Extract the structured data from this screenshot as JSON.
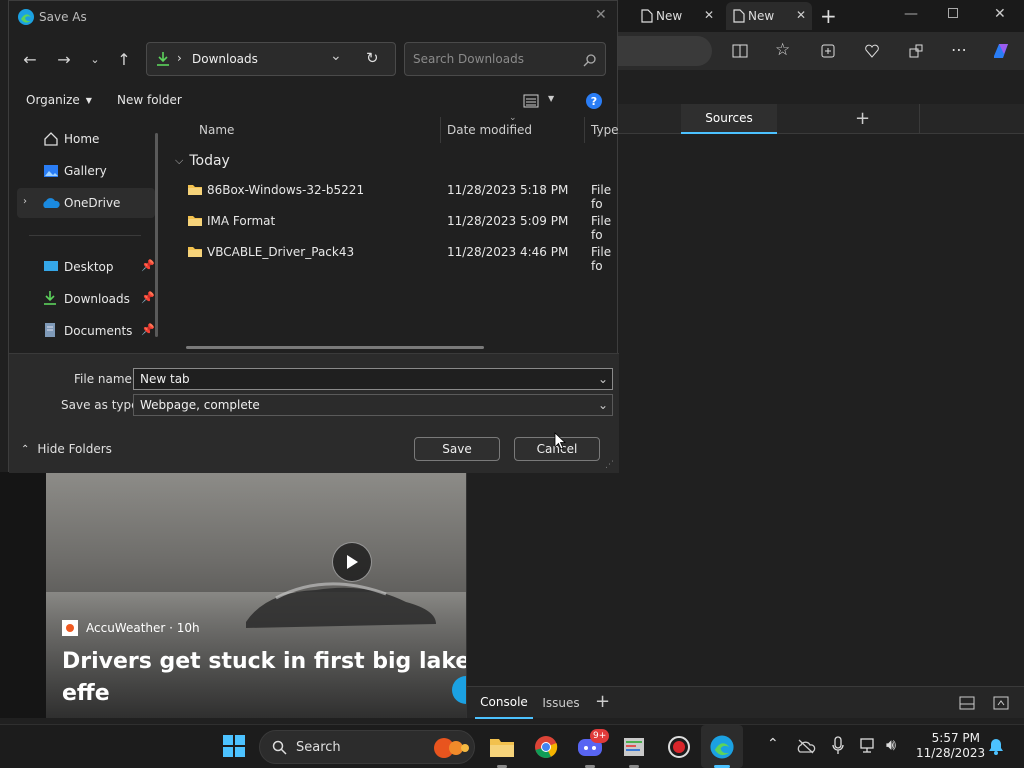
{
  "dialog": {
    "title": "Save As",
    "address": {
      "location": "Downloads"
    },
    "search": {
      "placeholder": "Search Downloads"
    },
    "commands": {
      "organize": "Organize",
      "new_folder": "New folder"
    },
    "sidebar": {
      "items": [
        {
          "label": "Home",
          "icon": "home-icon"
        },
        {
          "label": "Gallery",
          "icon": "gallery-icon"
        },
        {
          "label": "OneDrive",
          "icon": "onedrive-cloud-icon"
        },
        {
          "label": "Desktop",
          "icon": "desktop-icon",
          "pinned": true
        },
        {
          "label": "Downloads",
          "icon": "download-icon",
          "pinned": true
        },
        {
          "label": "Documents",
          "icon": "document-icon",
          "pinned": true
        }
      ]
    },
    "columns": {
      "name": "Name",
      "date": "Date modified",
      "type": "Type"
    },
    "group": "Today",
    "files": [
      {
        "name": "86Box-Windows-32-b5221",
        "date": "11/28/2023 5:18 PM",
        "type": "File fo"
      },
      {
        "name": "IMA Format",
        "date": "11/28/2023 5:09 PM",
        "type": "File fo"
      },
      {
        "name": "VBCABLE_Driver_Pack43",
        "date": "11/28/2023 4:46 PM",
        "type": "File fo"
      }
    ],
    "file_name": {
      "label": "File name:",
      "value": "New tab"
    },
    "save_type": {
      "label": "Save as type:",
      "value": "Webpage, complete"
    },
    "hide_folders": "Hide Folders",
    "save": "Save",
    "cancel": "Cancel"
  },
  "browser": {
    "tabs": [
      {
        "label": "New"
      },
      {
        "label": "New"
      }
    ],
    "devtools": {
      "top_tab": "Sources",
      "bottom_tabs": [
        "Console",
        "Issues"
      ]
    }
  },
  "news": {
    "source": "AccuWeather · 10h",
    "headline": "Drivers get stuck in first big lake-effe\nseason"
  },
  "taskbar": {
    "search": "Search",
    "badge": "9+",
    "time": "5:57 PM",
    "date": "11/28/2023"
  },
  "colors": {
    "accent": "#4cc2ff",
    "folder": "#f2c14e",
    "edge_blue": "#1ba1e2"
  }
}
